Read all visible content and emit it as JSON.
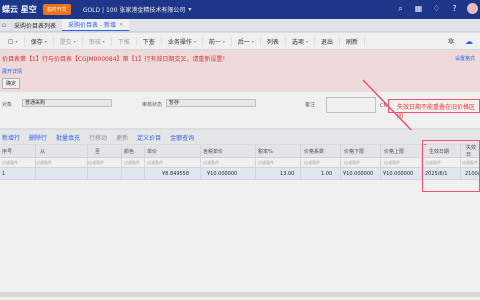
{
  "topbar": {
    "logo": "蝶云 星空",
    "logo_badge": "",
    "trial": "临时开发",
    "company": "GOLD | 100 张家港金精技术有限公司",
    "company_caret": "▾"
  },
  "tabs": [
    {
      "label": "采购价目表列表"
    },
    {
      "label": "采购价目表 - 新增",
      "close": "✕"
    }
  ],
  "toolbar": {
    "items": [
      "保存",
      "提交",
      "审核",
      "下推",
      "下查",
      "业务操作",
      "前一",
      "后一",
      "列表",
      "选项",
      "退出",
      "刷新"
    ]
  },
  "error": {
    "message": "价目表第【1】行与价目表【CGJM000084】第【1】行有效日期交叉，请重新设置！",
    "link": "设置格式",
    "detail": "展开详情",
    "ok": "确定"
  },
  "form": {
    "label1": "对象",
    "value1": "普通采购",
    "label2": "审核状态",
    "value2": "暂存",
    "label3": "备注",
    "value3": "",
    "cn": "CN"
  },
  "annotation": {
    "text": "失效日期不能重叠在旧价格区间"
  },
  "grid_toolbar": {
    "items": [
      "新增行",
      "删除行",
      "批量填充",
      "行移动",
      "更新",
      "定义价目",
      "金额查询"
    ]
  },
  "grid": {
    "headers": [
      "序号",
      "从",
      "至",
      "颜色",
      "单价",
      "含税单价",
      "税率%",
      "价格系数",
      "价格下限",
      "价格上限",
      "生效日期",
      "失效日"
    ],
    "filter": "过滤条件",
    "row": {
      "seq": "1",
      "price": "¥8.849558",
      "tax_price": "¥10.000000",
      "tax_rate": "13.00",
      "coef": "1.00",
      "low": "¥10.000000",
      "high": "¥10.000000",
      "effective": "2025/8/1",
      "expire": "2100/"
    }
  }
}
